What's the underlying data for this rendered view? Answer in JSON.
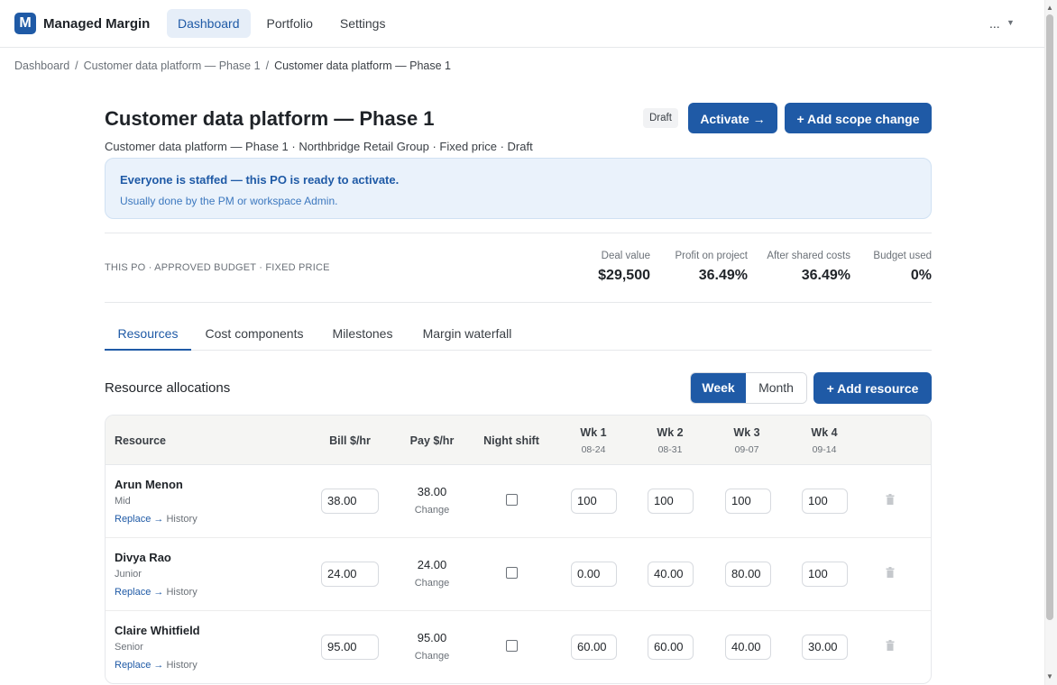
{
  "app": {
    "logo_letter": "M",
    "name": "Managed Margin"
  },
  "nav": {
    "items": [
      "Dashboard",
      "Portfolio",
      "Settings"
    ]
  },
  "user_menu": {
    "label": "..."
  },
  "breadcrumb": [
    "Dashboard",
    "Customer data platform — Phase 1",
    "Customer data platform — Phase 1"
  ],
  "breadcrumb_sep": "/",
  "page": {
    "title": "Customer data platform — Phase 1",
    "subtitle": "Customer data platform — Phase 1 · Northbridge Retail Group · Fixed price · Draft",
    "status_badge": "Draft",
    "activate_label": "Activate →",
    "add_scope_label": "+ Add scope change"
  },
  "banner": {
    "title": "Everyone is staffed — this PO is ready to activate.",
    "subtitle": "Usually done by the PM or workspace Admin."
  },
  "summary": {
    "label": "THIS PO · APPROVED BUDGET · FIXED PRICE",
    "kpis": [
      {
        "label": "Deal value",
        "value": "$29,500"
      },
      {
        "label": "Profit on project",
        "value": "36.49%"
      },
      {
        "label": "After shared costs",
        "value": "36.49%"
      },
      {
        "label": "Budget used",
        "value": "0%"
      }
    ]
  },
  "tabs": [
    "Resources",
    "Cost components",
    "Milestones",
    "Margin waterfall"
  ],
  "resources": {
    "title": "Resource allocations",
    "view_week": "Week",
    "view_month": "Month",
    "add_label": "+ Add resource",
    "columns": {
      "resource": "Resource",
      "bill": "Bill $/hr",
      "pay": "Pay $/hr",
      "night": "Night shift",
      "weeks": [
        {
          "label": "Wk 1",
          "date": "08-24"
        },
        {
          "label": "Wk 2",
          "date": "08-31"
        },
        {
          "label": "Wk 3",
          "date": "09-07"
        },
        {
          "label": "Wk 4",
          "date": "09-14"
        }
      ]
    },
    "replace_label": "Replace →",
    "history_label": "History",
    "change_label": "Change",
    "rows": [
      {
        "name": "Arun Menon",
        "level": "Mid",
        "bill": "38.00",
        "pay": "38.00",
        "night_shift": false,
        "weeks": [
          "100",
          "100",
          "100",
          "100"
        ]
      },
      {
        "name": "Divya Rao",
        "level": "Junior",
        "bill": "24.00",
        "pay": "24.00",
        "night_shift": false,
        "weeks": [
          "0.00",
          "40.00",
          "80.00",
          "100"
        ]
      },
      {
        "name": "Claire Whitfield",
        "level": "Senior",
        "bill": "95.00",
        "pay": "95.00",
        "night_shift": false,
        "weeks": [
          "60.00",
          "60.00",
          "40.00",
          "30.00"
        ]
      }
    ]
  },
  "colors": {
    "accent": "#1f5aa6",
    "banner_bg": "#eaf2fb",
    "banner_text": "#1f5aa6"
  }
}
